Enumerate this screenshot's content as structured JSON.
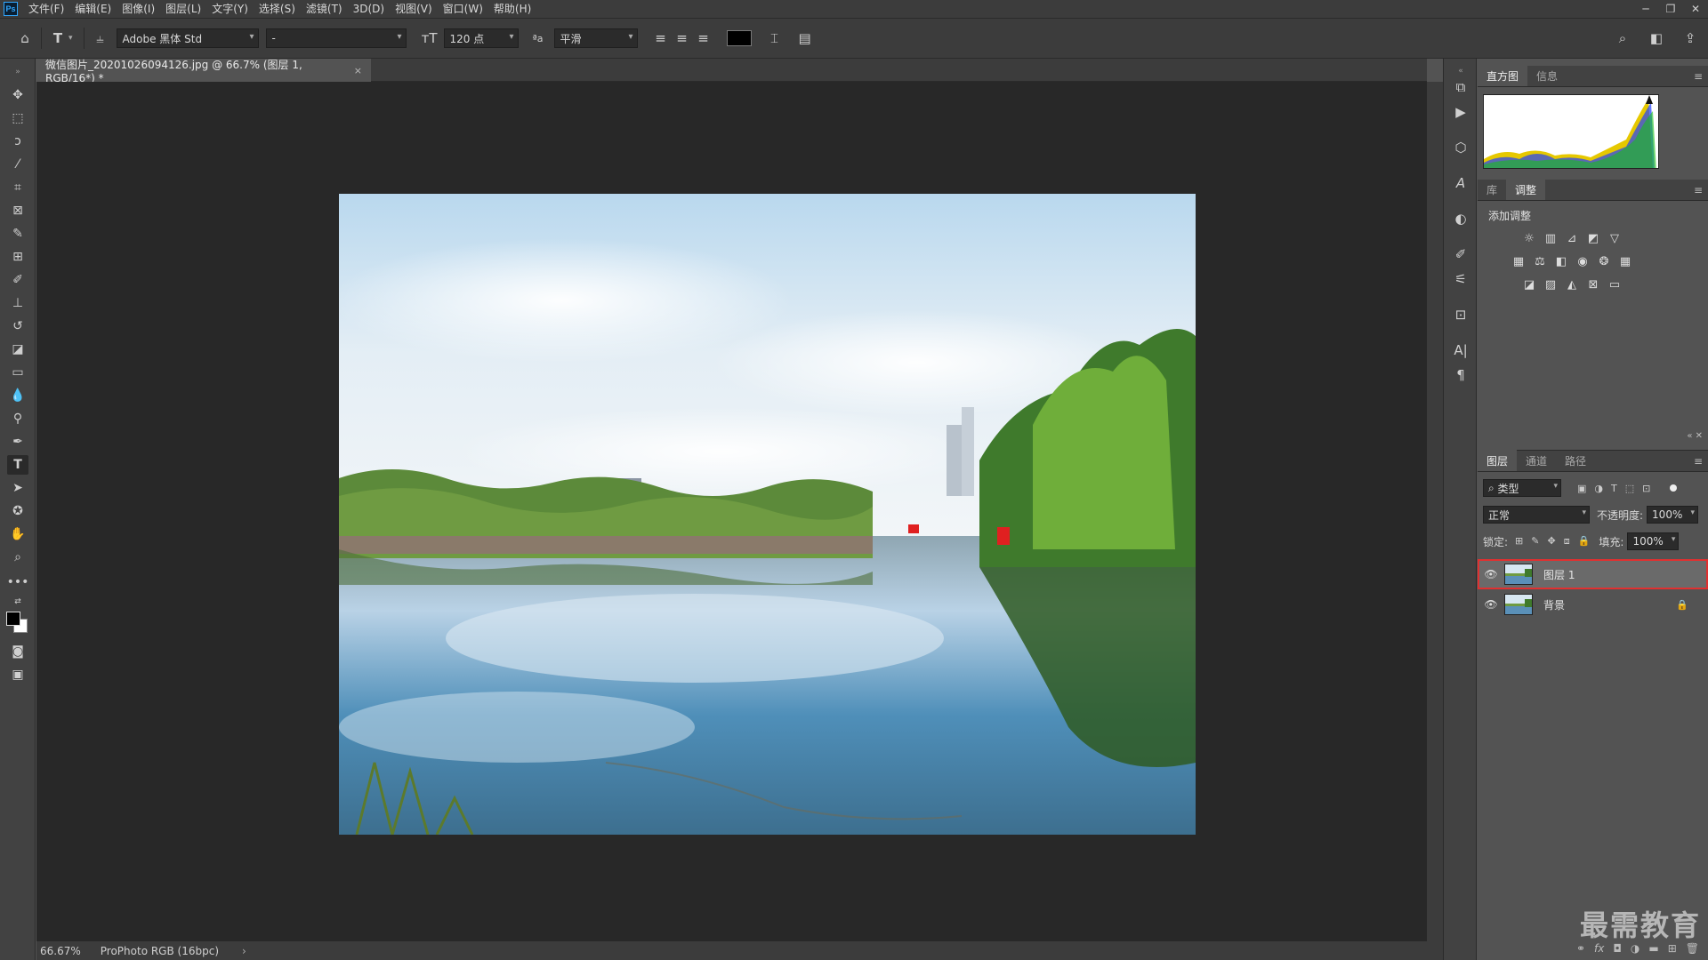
{
  "app": {
    "logo": "Ps"
  },
  "menubar": {
    "items": [
      "文件(F)",
      "编辑(E)",
      "图像(I)",
      "图层(L)",
      "文字(Y)",
      "选择(S)",
      "滤镜(T)",
      "3D(D)",
      "视图(V)",
      "窗口(W)",
      "帮助(H)"
    ],
    "window_controls": [
      "─",
      "❐",
      "✕"
    ]
  },
  "options": {
    "tool_glyph": "T",
    "font_family": "Adobe 黑体 Std",
    "font_style": "-",
    "font_size": "120 点",
    "antialias_glyph": "ªa",
    "antialias": "平滑",
    "text_color": "#000000"
  },
  "document": {
    "tab_title": "微信图片_20201026094126.jpg @ 66.7% (图层 1, RGB/16*) *",
    "close_glyph": "×"
  },
  "status": {
    "zoom": "66.67%",
    "profile": "ProPhoto RGB (16bpc)",
    "arrow": "›"
  },
  "panels": {
    "histogram": {
      "tabs": [
        "直方图",
        "信息"
      ]
    },
    "adjustments": {
      "tabs": [
        "库",
        "调整"
      ],
      "title": "添加调整"
    },
    "layers": {
      "tabs": [
        "图层",
        "通道",
        "路径"
      ],
      "filter_label": "类型",
      "blend_mode": "正常",
      "opacity_label": "不透明度:",
      "opacity_value": "100%",
      "lock_label": "锁定:",
      "fill_label": "填充:",
      "fill_value": "100%",
      "items": [
        {
          "name": "图层 1",
          "selected": true
        },
        {
          "name": "背景",
          "locked": true
        }
      ]
    }
  },
  "watermark": "最需教育",
  "colors": {
    "selection_border": "#e03030",
    "accent": "#31a8ff"
  }
}
